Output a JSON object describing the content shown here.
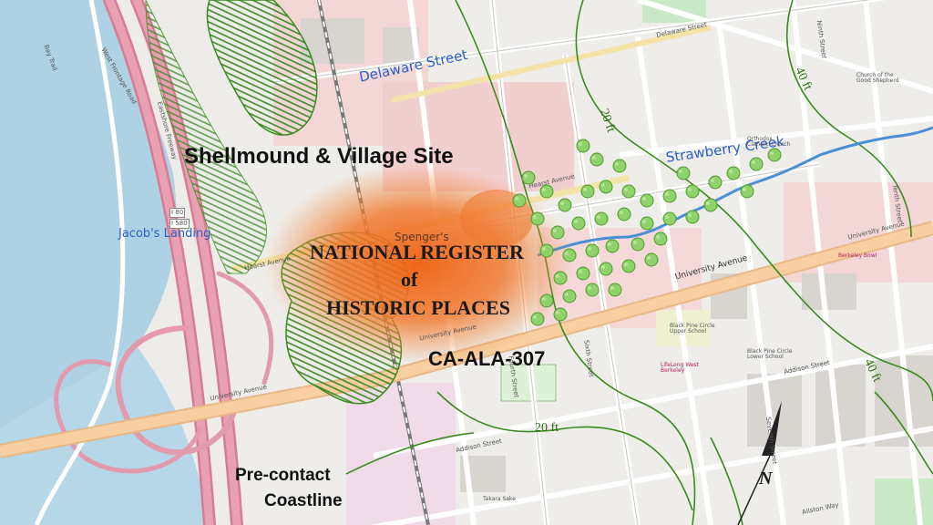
{
  "map": {
    "labels": {
      "shellmound": "Shellmound & Village Site",
      "jacobs_landing": "Jacob's Landing",
      "delaware_blue": "Delaware Street",
      "strawberry_creek": "Strawberry Creek",
      "register_line1": "NATIONAL REGISTER",
      "register_line2": "of",
      "register_line3": "HISTORIC PLACES",
      "site_code": "CA-ALA-307",
      "precontact_line1": "Pre-contact",
      "precontact_line2": "Coastline",
      "north": "N",
      "spengers": "Spenger's"
    },
    "contours": {
      "c20_top": "20 ft",
      "c20_bottom": "20 ft",
      "c40_top": "40 ft",
      "c40_right": "40 ft"
    },
    "streets": {
      "delaware": "Delaware Street",
      "hearst": "Hearst Avenue",
      "university": "University Avenue",
      "addison": "Addison Street",
      "fourth": "Fourth Street",
      "sixth": "Sixth Street",
      "ninth": "Ninth Street",
      "tenth": "Tenth Street",
      "seventh": "Seventh Street",
      "west_frontage": "West Frontage Road",
      "eastshore": "Eastshore Freeway",
      "bay_trail": "Bay Trail",
      "i80": "I 80",
      "i580": "I 580",
      "allston": "Allston Way"
    },
    "places": {
      "black_pine_upper": "Black Pine Circle Upper School",
      "black_pine_lower": "Black Pine Circle Lower School",
      "church": "Church of the Good Shepherd",
      "takara": "Takara Sake",
      "lifelong": "LifeLong West Berkeley",
      "orthodox": "Orthodox Catholic Church",
      "berkeley_bowl": "Berkeley Bowl"
    },
    "colors": {
      "freeway": "#e48fa2",
      "primary_road": "#f7cfa0",
      "creek": "#4a8fd6",
      "contour_line": "#3a8a1f",
      "overlay_orange": "#f07020",
      "water": "#aed2e4",
      "tree_green": "#8fd16a"
    }
  }
}
